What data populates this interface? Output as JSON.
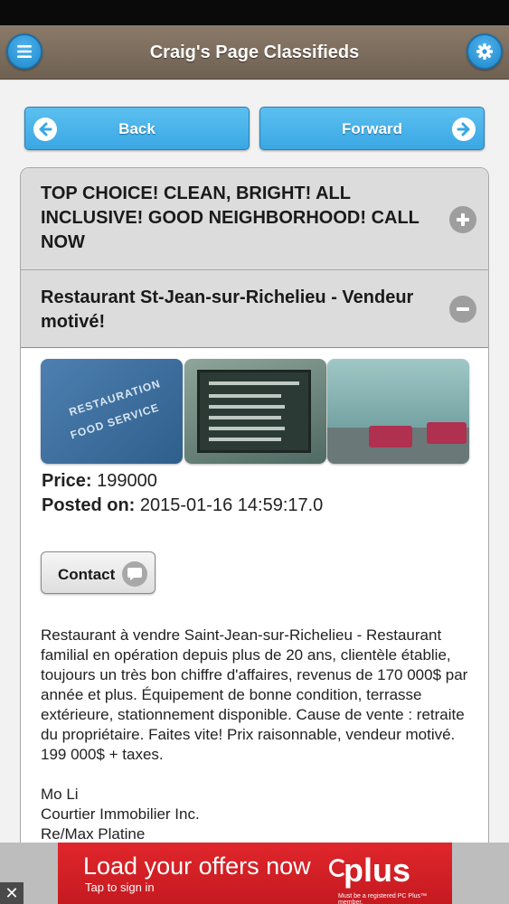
{
  "header": {
    "title": "Craig's Page Classifieds",
    "menu_icon": "hamburger-menu-icon",
    "settings_icon": "gear-icon"
  },
  "nav": {
    "back_label": "Back",
    "forward_label": "Forward"
  },
  "listings": [
    {
      "title": "TOP CHOICE! CLEAN, BRIGHT! ALL INCLUSIVE! GOOD NEIGHBORHOOD! CALL NOW",
      "state_icon": "plus-icon"
    },
    {
      "title": "Restaurant St-Jean-sur-Richelieu - Vendeur motivé!",
      "state_icon": "minus-icon"
    }
  ],
  "detail": {
    "photos": {
      "photo1_line1": "RESTAURATION",
      "photo1_line2": "FOOD SERVICE"
    },
    "price_label": "Price:",
    "price_value": "199000",
    "posted_label": "Posted on:",
    "posted_value": "2015-01-16 14:59:17.0",
    "contact_label": "Contact",
    "description": "Restaurant à vendre Saint-Jean-sur-Richelieu - Restaurant familial en opération depuis plus de 20 ans, clientèle établie, toujours un très bon chiffre d'affaires, revenus de 170 000$ par année et plus. Équipement de bonne condition, terrasse extérieure, stationnement disponible. Cause de vente : retraite du propriétaire. Faites vite! Prix raisonnable, vendeur motivé. 199 000$ + taxes.",
    "agent_name": "Mo Li",
    "agent_company": "Courtier Immobilier Inc.",
    "agent_agency": "Re/Max Platine"
  },
  "ad": {
    "close": "✕",
    "headline": "Load your offers now",
    "subline": "Tap to sign in",
    "brand": "plus",
    "fine_print": "Must be a registered PC Plus™ member."
  },
  "colors": {
    "header_bg": "#7d6e5f",
    "button_blue": "#3aa7e4",
    "ad_red": "#d42027"
  }
}
